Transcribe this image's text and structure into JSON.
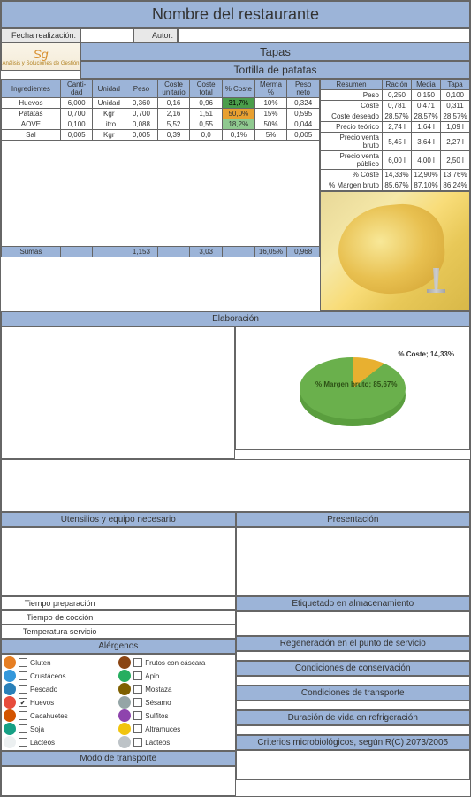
{
  "title": "Nombre del restaurante",
  "fecha_label": "Fecha realización:",
  "autor_label": "Autor:",
  "logo_text": "Análisis y Soluciones de Gestión",
  "category": "Tapas",
  "dish": "Tortilla de patatas",
  "headers": {
    "ingredientes": "Ingredientes",
    "cantidad": "Canti-\ndad",
    "unidad": "Unidad",
    "peso": "Peso",
    "coste_u": "Coste\nunitario",
    "coste_t": "Coste\ntotal",
    "pct_coste": "%\nCoste",
    "merma": "Merma\n%",
    "peso_neto": "Peso\nneto",
    "resumen": "Resumen",
    "racion": "Ración",
    "media": "Media",
    "tapa": "Tapa"
  },
  "ingredients": [
    {
      "n": "Huevos",
      "cant": "6,000",
      "uni": "Unidad",
      "peso": "0,360",
      "cu": "0,16",
      "ct": "0,96",
      "pct": "31,7%",
      "pcls": "pct-green",
      "merma": "10%",
      "pn": "0,324"
    },
    {
      "n": "Patatas",
      "cant": "0,700",
      "uni": "Kgr",
      "peso": "0,700",
      "cu": "2,16",
      "ct": "1,51",
      "pct": "50,0%",
      "pcls": "pct-orange",
      "merma": "15%",
      "pn": "0,595"
    },
    {
      "n": "AOVE",
      "cant": "0,100",
      "uni": "Litro",
      "peso": "0,088",
      "cu": "5,52",
      "ct": "0,55",
      "pct": "18,2%",
      "pcls": "pct-lgreen",
      "merma": "50%",
      "pn": "0,044"
    },
    {
      "n": "Sal",
      "cant": "0,005",
      "uni": "Kgr",
      "peso": "0,005",
      "cu": "0,39",
      "ct": "0,0",
      "pct": "0,1%",
      "pcls": "",
      "merma": "5%",
      "pn": "0,005"
    }
  ],
  "sumas": {
    "label": "Sumas",
    "peso": "1,153",
    "ct": "3,03",
    "merma": "16,05%",
    "pn": "0,968"
  },
  "resumen_rows": [
    {
      "l": "Peso",
      "r": "0,250",
      "m": "0,150",
      "t": "0,100"
    },
    {
      "l": "Coste",
      "r": "0,781",
      "m": "0,471",
      "t": "0,311"
    },
    {
      "l": "Coste deseado",
      "r": "28,57%",
      "m": "28,57%",
      "t": "28,57%"
    },
    {
      "l": "Precio teórico",
      "r": "2,74 l",
      "m": "1,64 l",
      "t": "1,09 l"
    },
    {
      "l": "Precio venta bruto",
      "r": "5,45 l",
      "m": "3,64 l",
      "t": "2,27 l"
    },
    {
      "l": "Precio venta público",
      "r": "6,00 l",
      "m": "4,00 l",
      "t": "2,50 l"
    },
    {
      "l": "% Coste",
      "r": "14,33%",
      "m": "12,90%",
      "t": "13,76%"
    },
    {
      "l": "% Margen bruto",
      "r": "85,67%",
      "m": "87,10%",
      "t": "86,24%"
    }
  ],
  "chart_data": {
    "type": "pie",
    "title": "",
    "series": [
      {
        "name": "% Coste",
        "value": 14.33,
        "label": "% Coste;\n14,33%",
        "color": "#e8b030"
      },
      {
        "name": "% Margen bruto",
        "value": 85.67,
        "label": "% Margen\nbruto;\n85,67%",
        "color": "#6ab04c"
      }
    ]
  },
  "sections": {
    "elaboracion": "Elaboración",
    "utensilios": "Utensilios y equipo necesario",
    "presentacion": "Presentación",
    "tiempo_prep": "Tiempo preparación",
    "tiempo_coc": "Tiempo de cocción",
    "temp_serv": "Temperatura servicio",
    "alergenos": "Alérgenos",
    "etiquetado": "Etiquetado en almacenamiento",
    "regeneracion": "Regeneración en el punto de servicio",
    "conservacion": "Condiciones de conservación",
    "transporte": "Condiciones de transporte",
    "duracion": "Duración de vida en refrigeración",
    "modo_transporte": "Modo de transporte",
    "criterios": "Criterios microbiológicos, según R(C) 2073/2005"
  },
  "allergens": [
    {
      "n": "Gluten",
      "c": "#e67e22",
      "chk": false
    },
    {
      "n": "Frutos con cáscara",
      "c": "#8b4513",
      "chk": false
    },
    {
      "n": "Crustáceos",
      "c": "#3498db",
      "chk": false
    },
    {
      "n": "Apio",
      "c": "#27ae60",
      "chk": false
    },
    {
      "n": "Pescado",
      "c": "#2980b9",
      "chk": false
    },
    {
      "n": "Mostaza",
      "c": "#7f6000",
      "chk": false
    },
    {
      "n": "Huevos",
      "c": "#e74c3c",
      "chk": true
    },
    {
      "n": "Sésamo",
      "c": "#95a5a6",
      "chk": false
    },
    {
      "n": "Cacahuetes",
      "c": "#d35400",
      "chk": false
    },
    {
      "n": "Sulfitos",
      "c": "#8e44ad",
      "chk": false
    },
    {
      "n": "Soja",
      "c": "#16a085",
      "chk": false
    },
    {
      "n": "Altramuces",
      "c": "#f1c40f",
      "chk": false
    },
    {
      "n": "Lácteos",
      "c": "#ecf0f1",
      "chk": false
    },
    {
      "n": "Lácteos",
      "c": "#bdc3c7",
      "chk": false
    }
  ]
}
